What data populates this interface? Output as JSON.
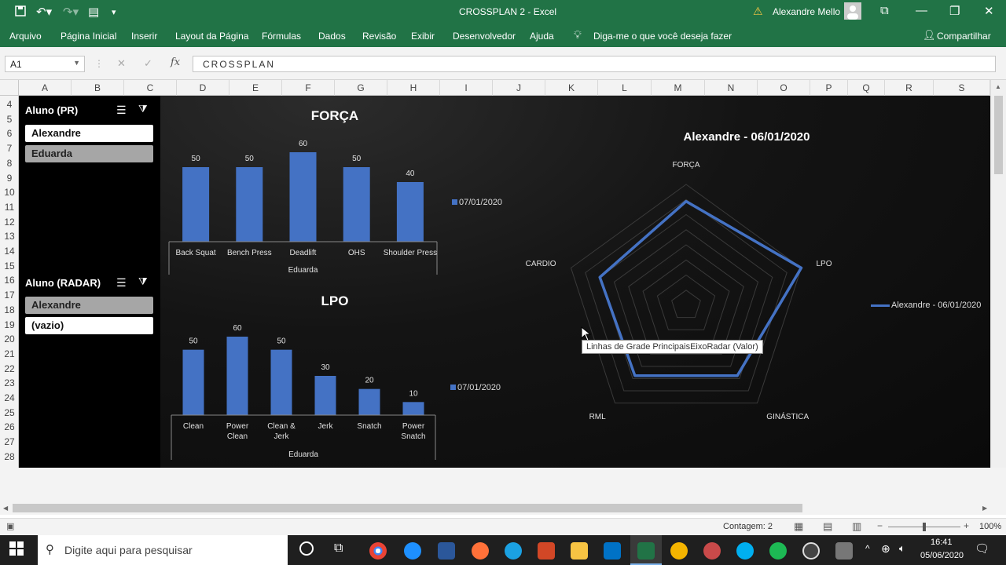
{
  "window": {
    "title": "CROSSPLAN 2  -  Excel",
    "user": "Alexandre Mello"
  },
  "ribbon": {
    "tabs": [
      "Arquivo",
      "Página Inicial",
      "Inserir",
      "Layout da Página",
      "Fórmulas",
      "Dados",
      "Revisão",
      "Exibir",
      "Desenvolvedor",
      "Ajuda"
    ],
    "tell_me": "Diga-me o que você deseja fazer",
    "share": "Compartilhar"
  },
  "formula_bar": {
    "name_box": "A1",
    "content": "CROSSPLAN"
  },
  "columns": [
    "A",
    "B",
    "C",
    "D",
    "E",
    "F",
    "G",
    "H",
    "I",
    "J",
    "K",
    "L",
    "M",
    "N",
    "O",
    "P",
    "Q",
    "R",
    "S"
  ],
  "rows": [
    "4",
    "5",
    "6",
    "7",
    "8",
    "9",
    "10",
    "11",
    "12",
    "13",
    "14",
    "15",
    "16",
    "17",
    "18",
    "19",
    "20",
    "21",
    "22",
    "23",
    "24",
    "25",
    "26",
    "27",
    "28"
  ],
  "slicers": [
    {
      "title": "Aluno (PR)",
      "items": [
        {
          "label": "Alexandre",
          "selected": true
        },
        {
          "label": "Eduarda",
          "selected": false
        }
      ]
    },
    {
      "title": "Aluno (RADAR)",
      "items": [
        {
          "label": "Alexandre",
          "selected": false
        },
        {
          "label": "(vazio)",
          "selected": true
        }
      ]
    }
  ],
  "chart_data": [
    {
      "type": "bar",
      "title": "FORÇA",
      "categories": [
        "Back Squat",
        "Bench Press",
        "Deadlift",
        "OHS",
        "Shoulder Press"
      ],
      "group_label": "Eduarda",
      "series": [
        {
          "name": "07/01/2020",
          "values": [
            50,
            50,
            60,
            50,
            40
          ],
          "color": "#4472c4"
        }
      ],
      "ylim": [
        0,
        60
      ]
    },
    {
      "type": "bar",
      "title": "LPO",
      "categories": [
        "Clean",
        "Power Clean",
        "Clean & Jerk",
        "Jerk",
        "Snatch",
        "Power Snatch"
      ],
      "group_label": "Eduarda",
      "series": [
        {
          "name": "07/01/2020",
          "values": [
            50,
            60,
            50,
            30,
            20,
            10
          ],
          "color": "#4472c4"
        }
      ],
      "ylim": [
        0,
        60
      ]
    },
    {
      "type": "radar",
      "title": "Alexandre - 06/01/2020",
      "axes": [
        "FORÇA",
        "LPO",
        "GINÁSTICA",
        "RML",
        "CARDIO"
      ],
      "series": [
        {
          "name": "Alexandre - 06/01/2020",
          "values": [
            0.86,
            1.0,
            0.72,
            0.72,
            0.75
          ],
          "color": "#4472c4"
        }
      ],
      "rings": 8
    }
  ],
  "tooltip": "Linhas de Grade PrincipaisEixoRadar (Valor)",
  "status": {
    "count": "Contagem: 2",
    "zoom": "100%"
  },
  "taskbar": {
    "search_placeholder": "Digite aqui para pesquisar",
    "time": "16:41",
    "date": "05/06/2020"
  },
  "colors": {
    "excel_green": "#217346",
    "bar": "#4472c4"
  }
}
